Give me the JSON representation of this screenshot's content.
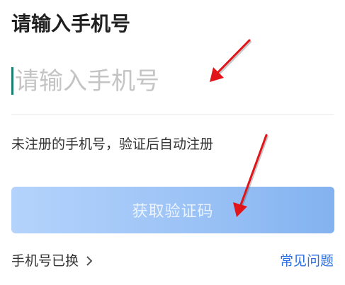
{
  "page": {
    "title": "请输入手机号"
  },
  "phone": {
    "placeholder": "请输入手机号",
    "value": ""
  },
  "hint": {
    "text": "未注册的手机号，验证后自动注册"
  },
  "actions": {
    "get_code_label": "获取验证码",
    "phone_changed_label": "手机号已换",
    "faq_label": "常见问题"
  },
  "colors": {
    "accent_link": "#2c6fe0",
    "cta_gradient_start": "#b4d3fb",
    "cta_gradient_end": "#83b2f0",
    "caret": "#1a7f6e",
    "annotation_arrow": "#e1141a"
  },
  "icons": {
    "chevron": "chevron-right-icon",
    "annotation": "red-arrow-icon"
  }
}
